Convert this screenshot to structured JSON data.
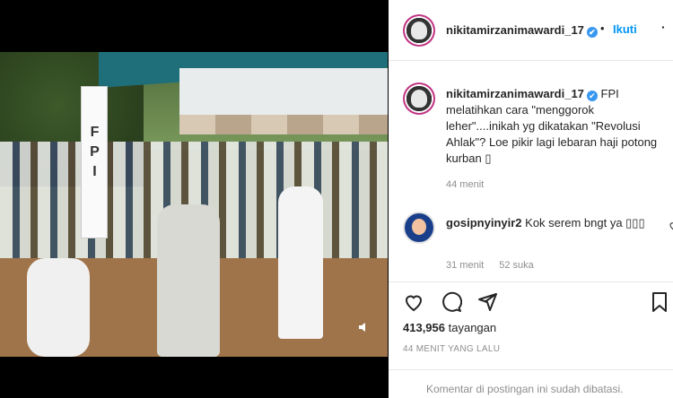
{
  "post": {
    "username": "nikitamirzanimawardi_17",
    "verified_mark": "✔",
    "separator": "•",
    "follow_label": "Ikuti",
    "more_label": "·",
    "caption": "FPI melatihkan cara \"menggorok leher\"....inikah yg dikatakan \"Revolusi Ahlak\"? Loe pikir lagi lebaran haji potong kurban ▯",
    "caption_time": "44 menit"
  },
  "video": {
    "sign_text": "FPI"
  },
  "comment": {
    "username": "gosipnyinyir2",
    "text": "Kok serem bngt ya ▯▯▯",
    "time": "31 menit",
    "likes": "52 suka"
  },
  "stats": {
    "views_count": "413,956",
    "views_label": "tayangan",
    "posted_ago": "44 MENIT YANG LALU"
  },
  "footer": {
    "comments_disabled": "Komentar di postingan ini sudah dibatasi."
  },
  "icons": {
    "like": "heart-icon",
    "comment": "comment-icon",
    "share": "share-icon",
    "save": "bookmark-icon",
    "mute": "speaker-icon"
  },
  "colors": {
    "link_blue": "#0095f6",
    "verified_blue": "#3897f0",
    "text": "#262626",
    "muted": "#8e8e8e"
  }
}
